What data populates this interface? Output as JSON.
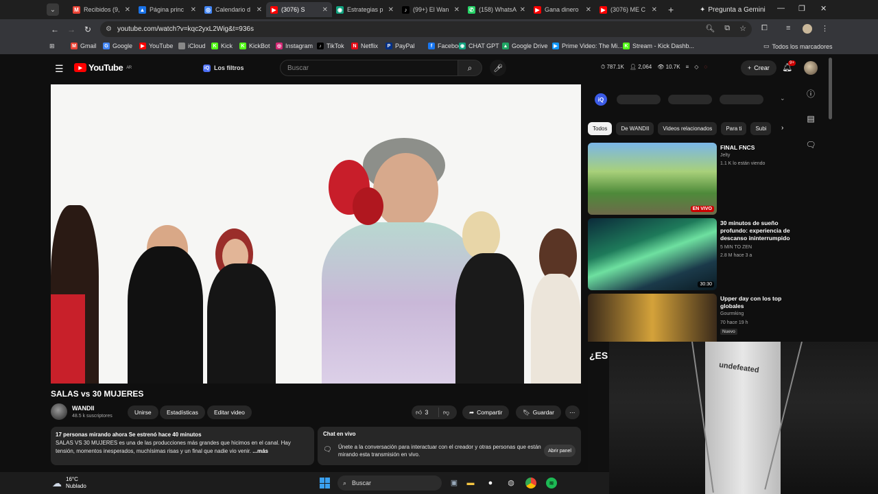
{
  "browser": {
    "tabs": [
      {
        "label": "Recibidos (9,",
        "color": "#ea4335",
        "glyph": "M"
      },
      {
        "label": "Página princ",
        "color": "#1a73e8",
        "glyph": "▲"
      },
      {
        "label": "Calendario d",
        "color": "#4285f4",
        "glyph": "◎"
      },
      {
        "label": "(3076) S",
        "color": "#ff0000",
        "glyph": "▶"
      },
      {
        "label": "Estrategias p",
        "color": "#10a37f",
        "glyph": "◉"
      },
      {
        "label": "(99+) El Wan",
        "color": "#000000",
        "glyph": "♪"
      },
      {
        "label": "(158) WhatsA",
        "color": "#25d366",
        "glyph": "✆"
      },
      {
        "label": "Gana dinero",
        "color": "#ff0000",
        "glyph": "▶"
      },
      {
        "label": "(3076) ME C",
        "color": "#ff0000",
        "glyph": "▶"
      }
    ],
    "gemini_label": "Pregunta a Gemini",
    "url": "youtube.com/watch?v=kqc2yxL2Wig&t=936s",
    "bookmarks": [
      {
        "label": "Gmail",
        "color": "#ea4335",
        "glyph": "M"
      },
      {
        "label": "Google",
        "color": "#4285f4",
        "glyph": "G"
      },
      {
        "label": "YouTube",
        "color": "#ff0000",
        "glyph": "▶"
      },
      {
        "label": "iCloud",
        "color": "#888888",
        "glyph": ""
      },
      {
        "label": "Kick",
        "color": "#53fc18",
        "glyph": "K"
      },
      {
        "label": "KickBot",
        "color": "#53fc18",
        "glyph": "K"
      },
      {
        "label": "Instagram",
        "color": "#d62976",
        "glyph": "◎"
      },
      {
        "label": "TikTok",
        "color": "#000000",
        "glyph": "♪"
      },
      {
        "label": "Netflix",
        "color": "#e50914",
        "glyph": "N"
      },
      {
        "label": "PayPal",
        "color": "#003087",
        "glyph": "P"
      },
      {
        "label": "Facebook",
        "color": "#1877f2",
        "glyph": "f"
      },
      {
        "label": "CHAT GPT",
        "color": "#10a37f",
        "glyph": "◉"
      },
      {
        "label": "Google Drive",
        "color": "#1fa463",
        "glyph": "▲"
      },
      {
        "label": "Prime Video: The Mi...",
        "color": "#1399ff",
        "glyph": "▶"
      },
      {
        "label": "Stream - Kick Dashb...",
        "color": "#53fc18",
        "glyph": "K"
      }
    ],
    "all_bookmarks_label": "Todos los marcadores"
  },
  "youtube": {
    "logo_text": "YouTube",
    "logo_region": "AR",
    "filters_label": "Los filtros",
    "search_placeholder": "Buscar",
    "stats": [
      "787.1K",
      "2,064",
      "10.7K"
    ],
    "create_label": "Crear",
    "notif_badge": "9+",
    "video": {
      "title": "SALAS vs 30 MUJERES",
      "channel": "WANDII",
      "subscribers": "48.5 k suscriptores",
      "buttons": [
        "Unirse",
        "Estadísticas",
        "Editar video"
      ],
      "likes": "3",
      "share_label": "Compartir",
      "save_label": "Guardar",
      "desc_bold": "17 personas mirando ahora  Se estrenó hace 40 minutos",
      "desc_text": "SALAS VS 30 MUJERES es una de las producciones más grandes que hicimos en el canal. Hay tensión, momentos inesperados, muchísimas risas y un final que nadie vio venir.",
      "desc_more": "...más"
    },
    "live_chat": {
      "title": "Chat en vivo",
      "description": "Únete a la conversación para interactuar con el creador y otras personas que están mirando esta transmisión en vivo.",
      "open_label": "Abrir panel"
    },
    "chips": [
      "Todos",
      "De WANDII",
      "Videos relacionados",
      "Para ti",
      "Subi"
    ],
    "recommendations": [
      {
        "title": "FINAL FNCS",
        "channel": "Jelty",
        "meta": "1.1 K lo están viendo",
        "badge": "EN VIVO",
        "badge_type": "live"
      },
      {
        "title": "30 minutos de sueño profundo: experiencia de descanso ininterrumpido",
        "channel": "5 MIN TO ZEN",
        "meta": "2.8 M  hace 3 a",
        "badge": "30:30",
        "badge_type": "duration"
      },
      {
        "title": "Upper day con los top globales",
        "channel": "Gourmking",
        "meta": "70  hace 19 h",
        "badge": "Nuevo",
        "badge_type": "new"
      }
    ]
  },
  "taskbar": {
    "temperature": "16°C",
    "weather": "Nublado",
    "search_label": "Buscar"
  },
  "webcam": {
    "shirt_text": "undefeated"
  }
}
